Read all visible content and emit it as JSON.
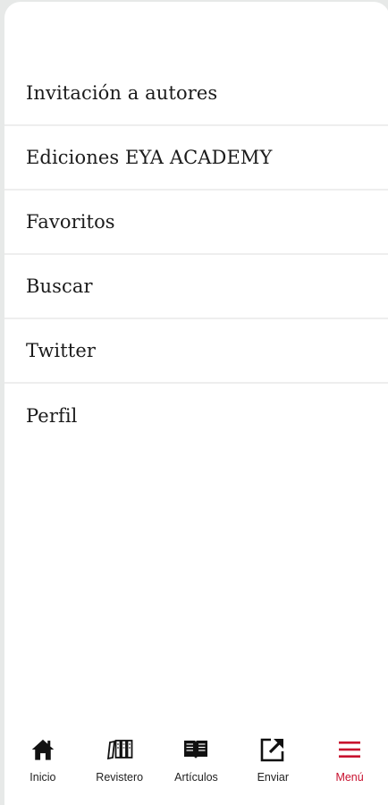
{
  "menu": {
    "items": [
      {
        "label": "Invitación a autores"
      },
      {
        "label": "Ediciones EYA ACADEMY"
      },
      {
        "label": "Favoritos"
      },
      {
        "label": "Buscar"
      },
      {
        "label": "Twitter"
      },
      {
        "label": "Perfil"
      }
    ]
  },
  "tabbar": {
    "tabs": [
      {
        "label": "Inicio",
        "icon": "home-icon"
      },
      {
        "label": "Revistero",
        "icon": "magazines-icon"
      },
      {
        "label": "Artículos",
        "icon": "open-book-icon"
      },
      {
        "label": "Enviar",
        "icon": "share-icon"
      },
      {
        "label": "Menú",
        "icon": "hamburger-menu-icon",
        "active": true
      }
    ]
  },
  "colors": {
    "accent": "#c8102e",
    "text": "#1b1b1b",
    "divider": "#eeeeee",
    "background": "#e7e9e8"
  }
}
